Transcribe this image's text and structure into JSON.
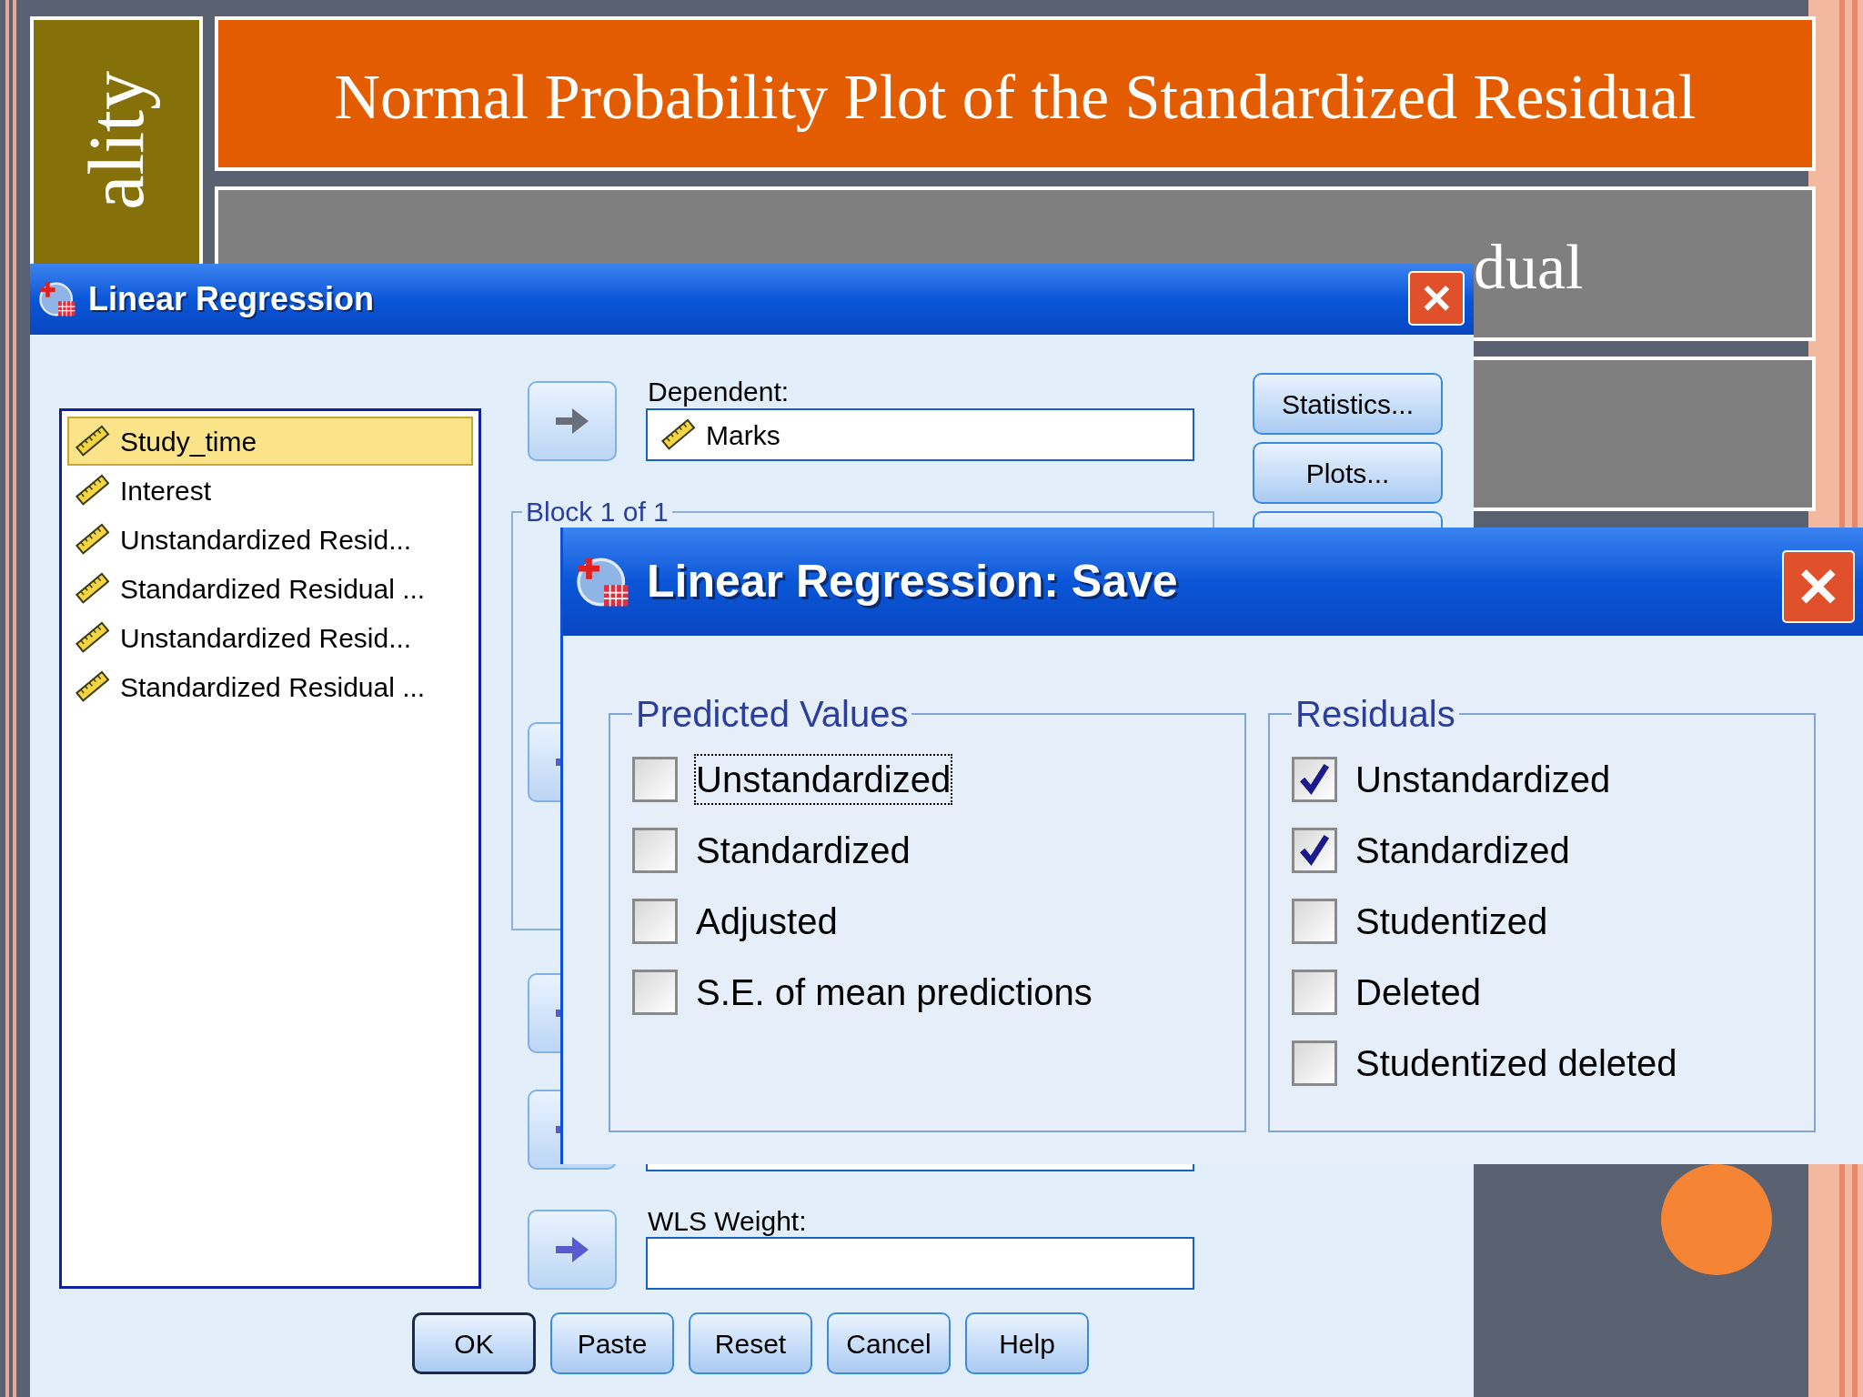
{
  "slide": {
    "side_label": "ality",
    "panels": [
      {
        "text": "Normal Probability Plot of the Standardized Residual",
        "color": "#e35d00"
      },
      {
        "text": "dual",
        "color": "#7f7f7f"
      },
      {
        "color": "#7f7f7f"
      }
    ]
  },
  "main_dialog": {
    "title": "Linear Regression",
    "variables": [
      {
        "name": "Study_time",
        "selected": true
      },
      {
        "name": "Interest",
        "selected": false
      },
      {
        "name": "Unstandardized Resid...",
        "selected": false
      },
      {
        "name": "Standardized Residual ...",
        "selected": false
      },
      {
        "name": "Unstandardized Resid...",
        "selected": false
      },
      {
        "name": "Standardized Residual ...",
        "selected": false
      }
    ],
    "dependent": {
      "label": "Dependent:",
      "value": "Marks"
    },
    "block_label": "Block 1 of 1",
    "wls": {
      "label": "WLS Weight:"
    },
    "side_buttons": [
      "Statistics...",
      "Plots..."
    ],
    "buttons": [
      {
        "label": "OK",
        "default": true
      },
      {
        "label": "Paste",
        "default": false
      },
      {
        "label": "Reset",
        "default": false
      },
      {
        "label": "Cancel",
        "default": false
      },
      {
        "label": "Help",
        "default": false
      }
    ]
  },
  "save_dialog": {
    "title": "Linear Regression: Save",
    "groups": [
      {
        "title": "Predicted Values",
        "options": [
          {
            "label": "Unstandardized",
            "checked": false,
            "focused": true
          },
          {
            "label": "Standardized",
            "checked": false,
            "focused": false
          },
          {
            "label": "Adjusted",
            "checked": false,
            "focused": false
          },
          {
            "label": "S.E. of mean predictions",
            "checked": false,
            "focused": false
          }
        ]
      },
      {
        "title": "Residuals",
        "options": [
          {
            "label": "Unstandardized",
            "checked": true,
            "focused": false
          },
          {
            "label": "Standardized",
            "checked": true,
            "focused": false
          },
          {
            "label": "Studentized",
            "checked": false,
            "focused": false
          },
          {
            "label": "Deleted",
            "checked": false,
            "focused": false
          },
          {
            "label": "Studentized deleted",
            "checked": false,
            "focused": false
          }
        ]
      }
    ]
  }
}
